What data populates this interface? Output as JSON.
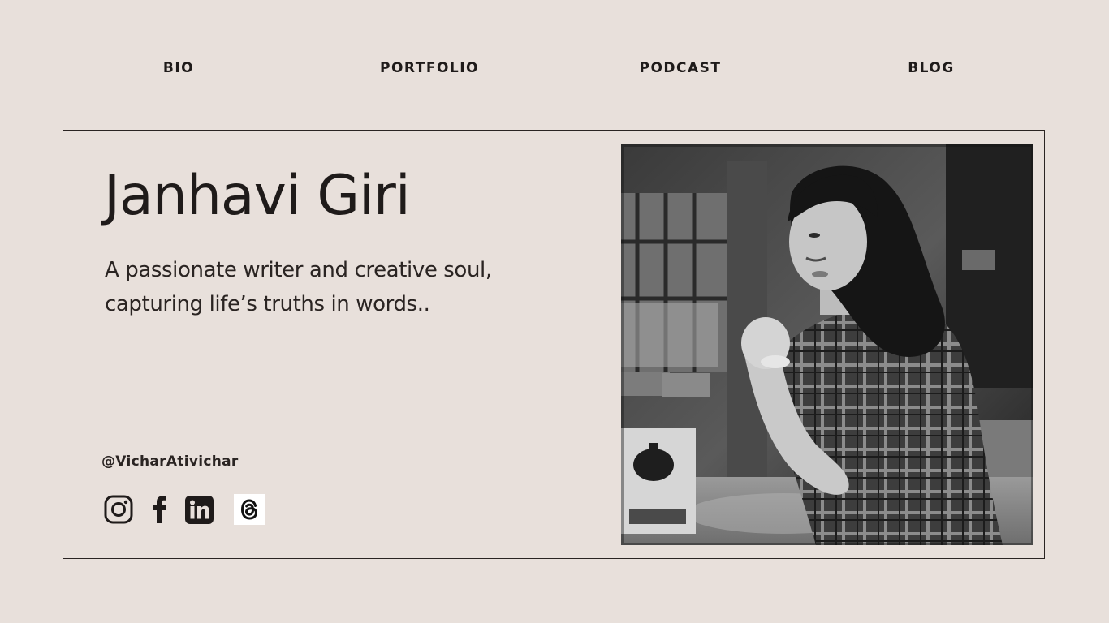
{
  "nav": {
    "items": [
      {
        "label": "BIO"
      },
      {
        "label": "PORTFOLIO"
      },
      {
        "label": "PODCAST"
      },
      {
        "label": "BLOG"
      }
    ]
  },
  "hero": {
    "name": "Janhavi Giri",
    "tagline_line1": "A passionate writer and creative soul,",
    "tagline_line2": "capturing life’s truths in words..",
    "handle": "@VicharAtivichar"
  },
  "social": {
    "icons": [
      "instagram-icon",
      "facebook-icon",
      "linkedin-icon",
      "threads-icon"
    ]
  },
  "photo": {
    "style": "black-and-white portrait"
  },
  "colors": {
    "background": "#e8e0db",
    "text": "#1f1b1a",
    "border": "#2a2422"
  }
}
